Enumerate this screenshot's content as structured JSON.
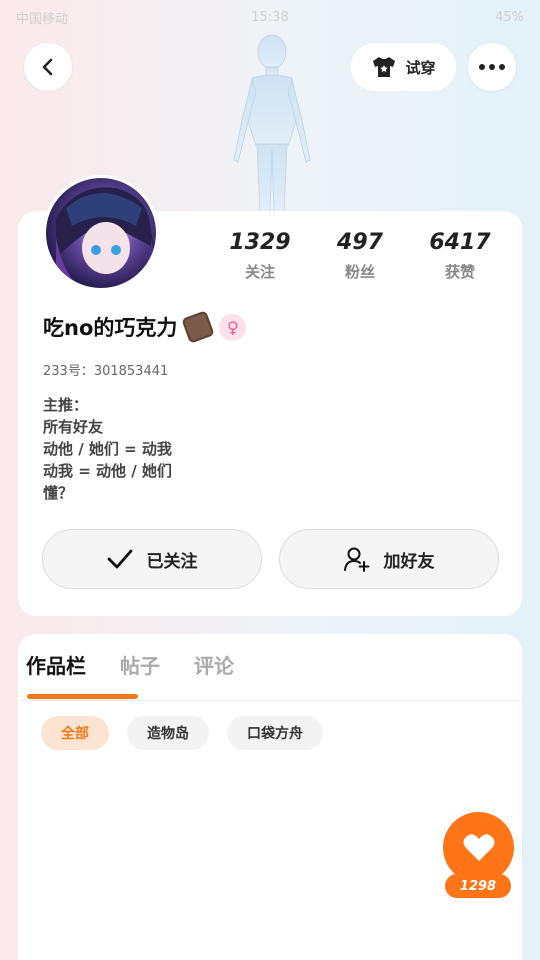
{
  "status_bar": {
    "left": "中国移动",
    "time": "15:38",
    "battery": "45%"
  },
  "header": {
    "tryon_label": "试穿"
  },
  "stats": [
    {
      "value": "1329",
      "label": "关注"
    },
    {
      "value": "497",
      "label": "粉丝"
    },
    {
      "value": "6417",
      "label": "获赞"
    }
  ],
  "profile": {
    "username": "吃no的巧克力",
    "gender_symbol": "♀",
    "id_line": "233号：301853441",
    "bio": [
      "主推：",
      "所有好友",
      "动他 / 她们 = 动我",
      "动我 = 动他 / 她们",
      "懂？"
    ]
  },
  "actions": {
    "follow_label": "已关注",
    "add_friend_label": "加好友"
  },
  "tabs": [
    "作品栏",
    "帖子",
    "评论"
  ],
  "filters": [
    "全部",
    "造物岛",
    "口袋方舟"
  ],
  "like": {
    "count": "1298"
  },
  "colors": {
    "accent": "#ff7416",
    "gender": "#ec5d8e"
  },
  "icons": {
    "back": "chevron-left-icon",
    "more": "more-dots-icon",
    "tryon": "tshirt-icon",
    "check": "check-icon",
    "add_friend": "person-add-icon",
    "heart": "heart-icon"
  }
}
